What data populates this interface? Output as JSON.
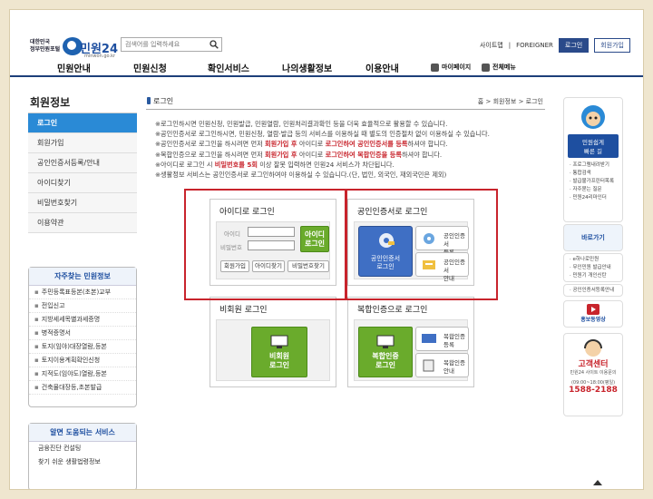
{
  "header": {
    "logo_gov": "대한민국\n정부민원포털",
    "logo_name": "민원24",
    "logo_url": "minwon.go.kr",
    "search_placeholder": "검색어를 입력하세요",
    "links": [
      "사이트맵",
      "FOREIGNER"
    ],
    "login_label": "로그인",
    "join_label": "회원가입"
  },
  "gnb": {
    "items": [
      "민원안내",
      "민원신청",
      "확인서비스",
      "나의생활정보",
      "이용안내"
    ],
    "mypage": "마이페이지",
    "allmenu": "전체메뉴"
  },
  "sidebar": {
    "title": "회원정보",
    "items": [
      "로그인",
      "회원가입",
      "공인인증서등록/안내",
      "아이디찾기",
      "비밀번호찾기",
      "이용약관"
    ]
  },
  "freq": {
    "title": "자주찾는 민원정보",
    "items": [
      "주민등록표등본(초본)교부",
      "전입신고",
      "지방세세목별과세증명",
      "병적증명서",
      "토지(임야)대장열람,등본",
      "토지이용계획확인신청",
      "지적도(임야도)열람,등본",
      "건축물대장등,초본발급"
    ]
  },
  "useful": {
    "title": "알면 도움되는 서비스",
    "items": [
      "금융진단 컨설팅",
      "찾기 쉬운 생활법령정보"
    ]
  },
  "page": {
    "title": "로그인",
    "crumb_home": "홈",
    "crumb_1": "회원정보",
    "crumb_2": "로그인"
  },
  "notices": [
    {
      "a": "※로그인하시면 민원신청, 민원발급, 민원열람, 민원처리결과확인 등을 더욱 효율적으로 활용할 수 있습니다.",
      "em": "",
      "b": "",
      "em2": "",
      "c": ""
    },
    {
      "a": "※공인인증서로 로그인하시면, 민원신청, 열람·발급 등의 서비스를 이용하실 때 별도의 인증절차 없이 이용하실 수 있습니다.",
      "em": "",
      "b": "",
      "em2": "",
      "c": ""
    },
    {
      "a": "※공인인증서로 로그인을 하시려면 먼저 ",
      "em": "회원가입 후",
      "b": " 아이디로 ",
      "em2": "로그인하여 공인인증서를 등록",
      "c": "하셔야 합니다."
    },
    {
      "a": "※복합인증으로 로그인을 하시려면 먼저 ",
      "em": "회원가입 후",
      "b": " 아이디로 ",
      "em2": "로그인하여 복합인증을 등록",
      "c": "하셔야 합니다."
    },
    {
      "a": "※아이디로 로그인 시 ",
      "em": "비밀번호를 5회",
      "b": " 이상 잘못 입력하면 민원24 서비스가 차단됩니다.",
      "em2": "",
      "c": ""
    },
    {
      "a": "※생활정보 서비스는 공인인증서로 로그인하여야 이용하실 수 있습니다.(단, 법인, 외국인, 재외국민은 제외)",
      "em": "",
      "b": "",
      "em2": "",
      "c": ""
    }
  ],
  "id_login": {
    "title": "아이디로 로그인",
    "id_label": "아이디",
    "pw_label": "비밀번호",
    "login_btn": "아이디\n로그인",
    "join": "회원가입",
    "find_id": "아이디찾기",
    "find_pw": "비밀번호찾기"
  },
  "cert_login": {
    "title": "공인인증서로 로그인",
    "main": "공인인증서\n로그인",
    "register": "공인인증서\n등록",
    "guide": "공인인증서\n안내"
  },
  "guest_login": {
    "title": "비회원 로그인",
    "btn": "비회원\n로그인"
  },
  "multi_login": {
    "title": "복합인증으로 로그인",
    "main": "복합인증\n로그인",
    "register": "복합인증\n등록",
    "guide": "복합인증\n안내"
  },
  "right_rail": {
    "top_title": "민원쉽게\n빠른 길",
    "list": [
      "· 프로그램내려받기",
      "· 통합검색",
      "· 발급불가프린터목록",
      "· 자주묻는 질문",
      "· 민원24리마인더"
    ],
    "banner1": "바로가기",
    "list2": [
      "· e하나로민원",
      "· 무인민원 발급안내",
      "· 민원기 개인신탄"
    ],
    "cert_list": "· 공인인증서등록안내",
    "promo": "홍보동영상",
    "center_title": "고객센터",
    "center_sub": "민원24 사이트 이용문의",
    "center_hours": "(09:00~18:00(평일)",
    "center_phone": "1588-2188"
  },
  "colors": {
    "accent_blue": "#2a8ad6",
    "nav_blue": "#1d3f7a",
    "green": "#6aab2c",
    "red": "#c8242c"
  }
}
